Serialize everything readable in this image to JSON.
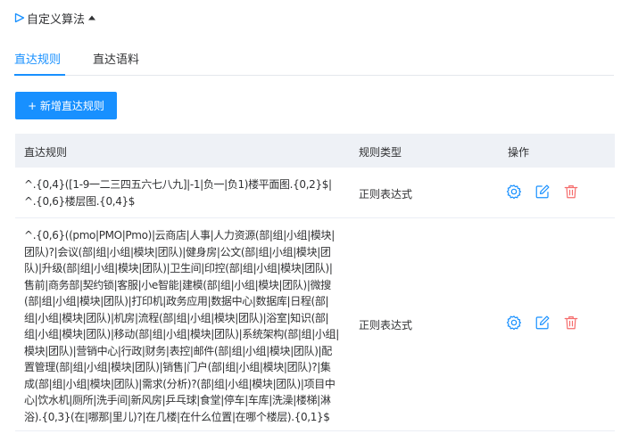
{
  "section": {
    "title": "自定义算法",
    "expand_icon": "play-triangle-icon",
    "collapse_icon": "caret-up-icon"
  },
  "tabs": [
    {
      "label": "直达规则",
      "active": true
    },
    {
      "label": "直达语料",
      "active": false
    }
  ],
  "toolbar": {
    "add_label": "+ 新增直达规则"
  },
  "table": {
    "columns": [
      "直达规则",
      "规则类型",
      "操作"
    ],
    "rows": [
      {
        "rule": "^.{0,4}([1-9一二三四五六七八九]|-1|负一|负1)楼平面图.{0,2}$|^.{0,6}楼层图.{0,4}$",
        "type": "正则表达式"
      },
      {
        "rule": "^.{0,6}((pmo|PMO|Pmo)|云商店|人事|人力资源(部|组|小组|模块|团队)?|会议(部|组|小组|模块|团队)|健身房|公文(部|组|小组|模块|团队)|升级(部|组|小组|模块|团队)|卫生间|印控(部|组|小组|模块|团队)|售前|商务部|契约锁|客服|小e智能|建模(部|组|小组|模块|团队)|微搜(部|组|小组|模块|团队)|打印机|政务应用|数据中心|数据库|日程(部|组|小组|模块|团队)|机房|流程(部|组|小组|模块|团队)|浴室|知识(部|组|小组|模块|团队)|移动(部|组|小组|模块|团队)|系统架构(部|组|小组|模块|团队)|营销中心|行政|财务|表控|邮件(部|组|小组|模块|团队)|配置管理(部|组|小组|模块|团队)|销售|门户(部|组|小组|模块|团队)?|集成(部|组|小组|模块|团队)|需求(分析)?(部|组|小组|模块|团队)|项目中心|饮水机|厕所|洗手间|新风房|乒乓球|食堂|停车|车库|洗澡|楼梯|淋浴).{0,3}(在|哪那|里儿)?|在几楼|在什么位置|在哪个楼层).{0,1}$",
        "type": "正则表达式"
      }
    ]
  },
  "colors": {
    "primary": "#1890ff",
    "danger": "#f56c6c",
    "header_bg": "#eef1f6"
  },
  "icons": [
    "gear-icon",
    "edit-icon",
    "trash-icon"
  ]
}
